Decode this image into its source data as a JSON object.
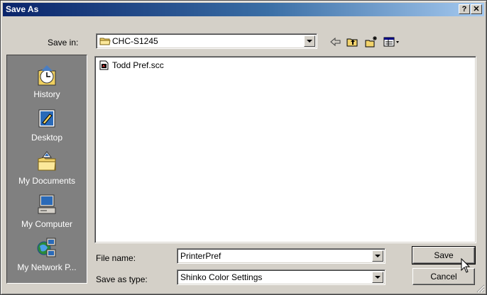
{
  "window": {
    "title": "Save As",
    "help_label": "?",
    "close_label": "✕"
  },
  "save_in": {
    "label": "Save in:",
    "value": "CHC-S1245"
  },
  "places": [
    {
      "label": "History",
      "icon": "history-icon"
    },
    {
      "label": "Desktop",
      "icon": "desktop-icon"
    },
    {
      "label": "My Documents",
      "icon": "my-documents-icon"
    },
    {
      "label": "My Computer",
      "icon": "my-computer-icon"
    },
    {
      "label": "My Network P...",
      "icon": "my-network-places-icon"
    }
  ],
  "files": [
    {
      "name": "Todd Pref.scc",
      "icon": "settings-file-icon"
    }
  ],
  "file_name": {
    "label": "File name:",
    "value": "PrinterPref"
  },
  "save_as_type": {
    "label": "Save as type:",
    "value": "Shinko Color Settings"
  },
  "buttons": {
    "save": "Save",
    "cancel": "Cancel"
  },
  "colors": {
    "title_start": "#0a246a",
    "title_end": "#a6caf0",
    "face": "#d4d0c8"
  }
}
